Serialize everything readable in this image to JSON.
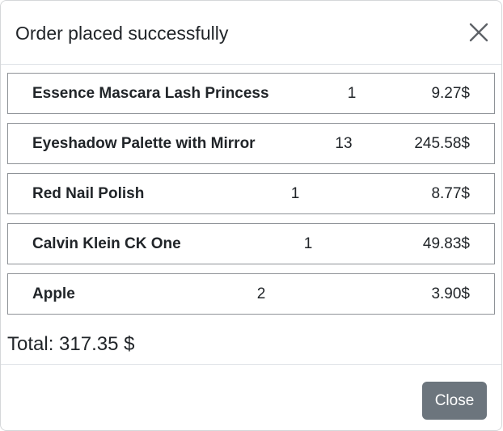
{
  "modal": {
    "title": "Order placed successfully",
    "close_icon": "close-icon"
  },
  "order": {
    "items": [
      {
        "name": "Essence Mascara Lash Princess",
        "quantity": "1",
        "price": "9.27$"
      },
      {
        "name": "Eyeshadow Palette with Mirror",
        "quantity": "13",
        "price": "245.58$"
      },
      {
        "name": "Red Nail Polish",
        "quantity": "1",
        "price": "8.77$"
      },
      {
        "name": "Calvin Klein CK One",
        "quantity": "1",
        "price": "49.83$"
      },
      {
        "name": "Apple",
        "quantity": "2",
        "price": "3.90$"
      }
    ],
    "total_label": "Total: 317.35 $"
  },
  "footer": {
    "close_label": "Close"
  },
  "colors": {
    "close_button_bg": "#6c757d",
    "row_border": "#8e9297",
    "divider": "#dee2e6"
  }
}
